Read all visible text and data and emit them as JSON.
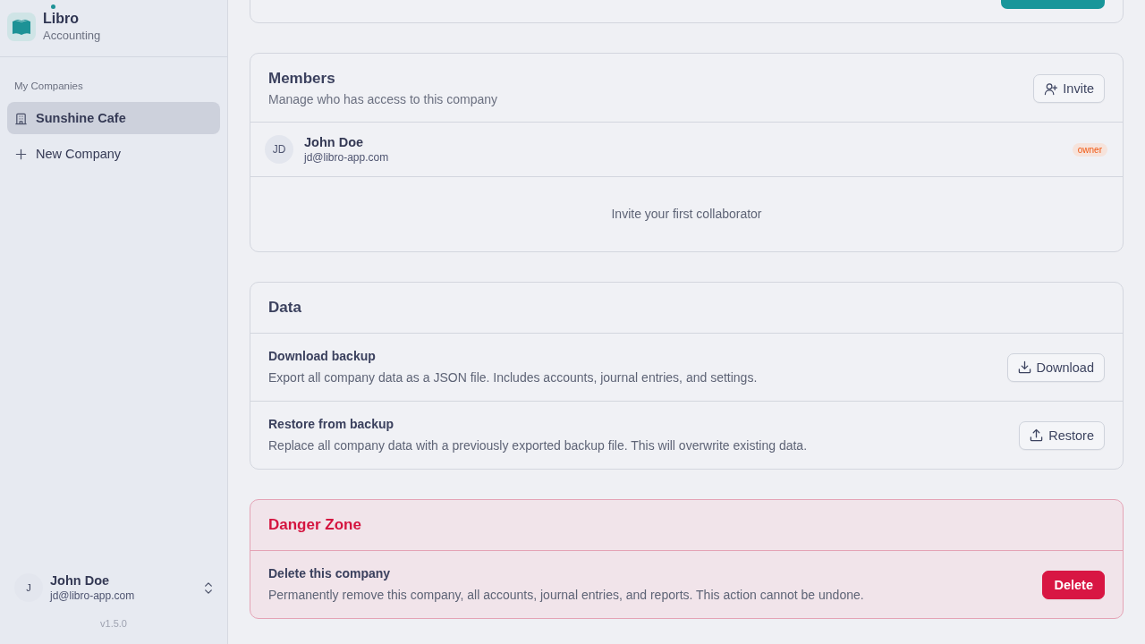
{
  "sidebar": {
    "brand": {
      "name": "Libro",
      "subtitle": "Accounting"
    },
    "section_label": "My Companies",
    "companies": [
      {
        "name": "Sunshine Cafe",
        "selected": true
      }
    ],
    "new_company": "New Company",
    "user": {
      "initial": "J",
      "name": "John Doe",
      "email": "jd@libro-app.com"
    },
    "version": "v1.5.0"
  },
  "members": {
    "title": "Members",
    "subtitle": "Manage who has access to this company",
    "invite_button": "Invite",
    "list": [
      {
        "initials": "JD",
        "name": "John Doe",
        "email": "jd@libro-app.com",
        "role": "owner"
      }
    ],
    "empty_text": "Invite your first collaborator"
  },
  "data": {
    "title": "Data",
    "rows": [
      {
        "kind": "download",
        "title": "Download backup",
        "description": "Export all company data as a JSON file. Includes accounts, journal entries, and settings.",
        "button": "Download"
      },
      {
        "kind": "restore",
        "title": "Restore from backup",
        "description": "Replace all company data with a previously exported backup file. This will overwrite existing data.",
        "button": "Restore"
      }
    ]
  },
  "danger_zone": {
    "title": "Danger Zone",
    "rows": [
      {
        "title": "Delete this company",
        "description": "Permanently remove this company, all accounts, journal entries, and reports. This action cannot be undone.",
        "button": "Delete"
      }
    ]
  }
}
